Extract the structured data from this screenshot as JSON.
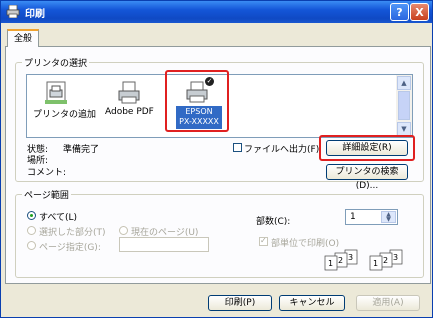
{
  "window": {
    "title": "印刷",
    "help_label": "?",
    "close_label": "X"
  },
  "tabs": [
    {
      "label": "全般"
    }
  ],
  "printer_group": {
    "legend": "プリンタの選択",
    "printers": [
      {
        "label": "プリンタの追加",
        "icon": "add-printer-icon"
      },
      {
        "label": "Adobe PDF",
        "icon": "printer-icon"
      },
      {
        "label": "EPSON\nPX-XXXXX",
        "name_line1": "EPSON",
        "name_line2": "PX-XXXXX",
        "selected": true,
        "default": true,
        "icon": "printer-icon"
      }
    ],
    "status_label": "状態:",
    "status_value": "準備完了",
    "location_label": "場所:",
    "location_value": "",
    "comment_label": "コメント:",
    "comment_value": "",
    "print_to_file_label": "ファイルへ出力(F)",
    "print_to_file_checked": false,
    "preferences_button": "詳細設定(R)",
    "find_printer_button": "プリンタの検索(D)..."
  },
  "page_range_group": {
    "legend": "ページ範囲",
    "all_label": "すべて(L)",
    "selection_label": "選択した部分(T)",
    "current_page_label": "現在のページ(U)",
    "pages_label": "ページ指定(G):",
    "pages_value": "",
    "selected": "all",
    "copies_label": "部数(C):",
    "copies_value": "1",
    "collate_label": "部単位で印刷(O)",
    "collate_checked": true
  },
  "footer": {
    "print_button": "印刷(P)",
    "cancel_button": "キャンセル",
    "apply_button": "適用(A)"
  },
  "colors": {
    "highlight": "#e02020",
    "title_bar": "#1456d8",
    "selection": "#316ac5"
  }
}
